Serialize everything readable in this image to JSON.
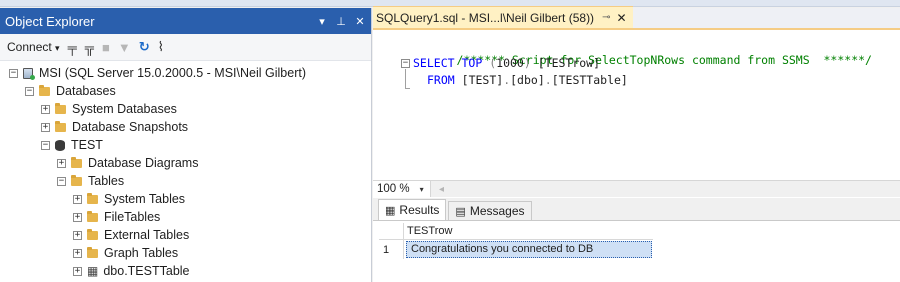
{
  "object_explorer": {
    "title": "Object Explorer",
    "title_controls": [
      "▾",
      "⊥",
      "✕"
    ],
    "toolbar": {
      "connect_label": "Connect",
      "connect_dropdown": "▾",
      "icons": [
        "filter-connect-icon",
        "filter-disconnect-icon",
        "stop-icon",
        "filter-icon",
        "refresh-icon",
        "activity-monitor-icon"
      ]
    },
    "tree": [
      {
        "label": "MSI (SQL Server 15.0.2000.5 - MSI\\Neil Gilbert)",
        "expander": "−",
        "icon": "server-icon",
        "level": 0
      },
      {
        "label": "Databases",
        "expander": "−",
        "icon": "folder-icon",
        "level": 1
      },
      {
        "label": "System Databases",
        "expander": "+",
        "icon": "folder-icon",
        "level": 2
      },
      {
        "label": "Database Snapshots",
        "expander": "+",
        "icon": "folder-icon",
        "level": 2
      },
      {
        "label": "TEST",
        "expander": "−",
        "icon": "database-icon",
        "level": 2
      },
      {
        "label": "Database Diagrams",
        "expander": "+",
        "icon": "folder-icon",
        "level": 3
      },
      {
        "label": "Tables",
        "expander": "−",
        "icon": "folder-icon",
        "level": 3
      },
      {
        "label": "System Tables",
        "expander": "+",
        "icon": "folder-icon",
        "level": 4
      },
      {
        "label": "FileTables",
        "expander": "+",
        "icon": "folder-icon",
        "level": 4
      },
      {
        "label": "External Tables",
        "expander": "+",
        "icon": "folder-icon",
        "level": 4
      },
      {
        "label": "Graph Tables",
        "expander": "+",
        "icon": "folder-icon",
        "level": 4
      },
      {
        "label": "dbo.TESTTable",
        "expander": "+",
        "icon": "table-icon",
        "level": 4
      }
    ]
  },
  "editor": {
    "tab": {
      "label": "SQLQuery1.sql - MSI...l\\Neil Gilbert (58))",
      "pin": "⊸",
      "close": "✕"
    },
    "code": {
      "comment": "/****** Script for SelectTopNRows command from SSMS  ******/",
      "line2": {
        "kw1": "SELECT",
        "kw2": "TOP",
        "paren_open": "(",
        "num": "1000",
        "paren_close": ")",
        "col": "[TESTrow]"
      },
      "line3": {
        "kw": "FROM",
        "obj": "[TEST]",
        "dot1": ".",
        "schema": "[dbo]",
        "dot2": ".",
        "table": "[TESTTable]"
      }
    },
    "zoom": "100 %",
    "zoom_dropdown": "▾",
    "scroll_left": "◂"
  },
  "results": {
    "tabs": [
      {
        "label": "Results",
        "icon": "grid-icon"
      },
      {
        "label": "Messages",
        "icon": "messages-icon"
      }
    ],
    "column_header": "TESTrow",
    "rows": [
      {
        "num": "1",
        "value": "Congratulations you connected to DB"
      }
    ]
  },
  "colors": {
    "title_bar": "#2a5fad",
    "tab_active": "#fff1c4",
    "keyword": "#0000ff",
    "comment": "#008000",
    "selection": "#cfe0f5"
  }
}
